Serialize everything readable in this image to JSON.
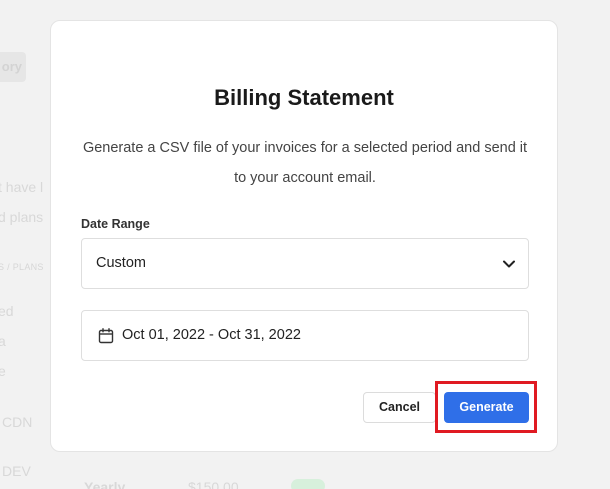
{
  "background": {
    "tab_fragment": "ory",
    "line1": "t have l",
    "line2": "d plans",
    "section_label": "S / PLANS",
    "item1": "ed",
    "item2": "a",
    "item3": "e",
    "item4": "CDN",
    "item5": "DEV",
    "row_period": "Yearly",
    "row_price": "$150.00"
  },
  "modal": {
    "title": "Billing Statement",
    "description": "Generate a CSV file of your invoices for a selected period and send it to your account email.",
    "date_range_label": "Date Range",
    "date_range_value": "Custom",
    "date_value": "Oct 01, 2022 - Oct 31, 2022",
    "cancel_label": "Cancel",
    "generate_label": "Generate"
  },
  "colors": {
    "accent": "#2f6fe8",
    "highlight": "#e01a22"
  },
  "icons": {
    "select_chevron": "chevron-down-icon",
    "date_picker": "calendar-icon"
  }
}
